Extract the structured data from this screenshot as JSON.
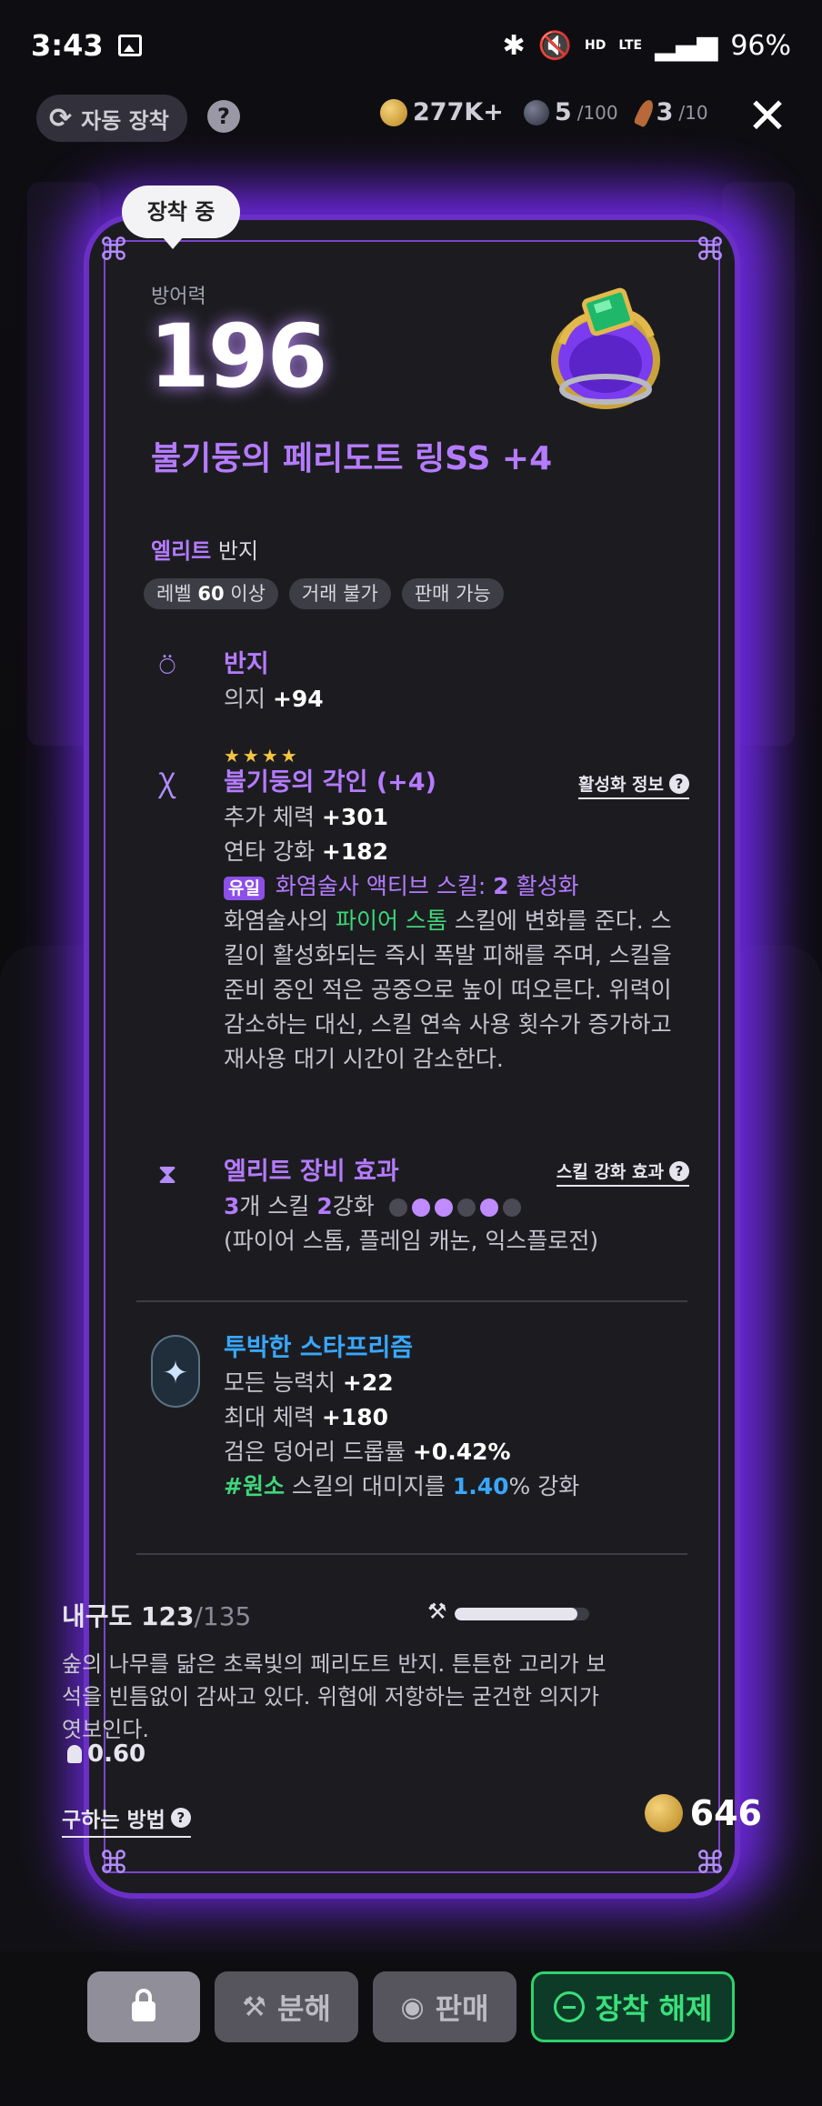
{
  "status_bar": {
    "time": "3:43",
    "battery": "96%",
    "network_hd": "HD",
    "network_lte": "LTE"
  },
  "top_bar": {
    "auto_equip_label": "자동 장착",
    "help": "?",
    "gold": "277K+",
    "orb_value": "5",
    "orb_max": "/100",
    "feather_value": "3",
    "feather_max": "/10",
    "close": "✕"
  },
  "item": {
    "equipped_badge": "장착 중",
    "stat_label": "방어력",
    "stat_value": "196",
    "name": "불기둥의 페리도트 링SS +4",
    "rarity": "엘리트",
    "type": "반지",
    "tags": {
      "level_prefix": "레벨",
      "level_value": "60",
      "level_suffix": "이상",
      "trade": "거래 불가",
      "sell": "판매 가능"
    },
    "base": {
      "title": "반지",
      "stat_name": "의지",
      "stat_value": "+94"
    },
    "engraving": {
      "stars": "★★★★",
      "title": "불기둥의 각인 (+4)",
      "info_link": "활성화 정보",
      "stat1_name": "추가 체력",
      "stat1_value": "+301",
      "stat2_name": "연타 강화",
      "stat2_value": "+182",
      "unique_badge": "유일",
      "active_skill_text": "화염술사 액티브 스킬:",
      "active_skill_value": "2",
      "active_skill_suffix": "활성화",
      "desc_prefix": "화염술사의",
      "desc_skill": "파이어 스톰",
      "desc_suffix": "스킬에 변화를 준다.",
      "desc_rest": "스킬이 활성화되는 즉시 폭발 피해를 주며, 스킬을 준비 중인 적은 공중으로 높이 떠오른다. 위력이 감소하는 대신, 스킬 연속 사용 횟수가 증가하고 재사용 대기 시간이 감소한다."
    },
    "elite_effect": {
      "title": "엘리트 장비 효과",
      "info_link": "스킬 강화 효과",
      "count": "3",
      "count_suffix": "개 스킬",
      "level": "2",
      "level_suffix": "강화",
      "dots_on": [
        false,
        true,
        true,
        false,
        true,
        false
      ],
      "skills": "(파이어 스톰, 플레임 캐논, 익스플로전)"
    },
    "prism": {
      "title": "투박한 스타프리즘",
      "s1_name": "모든 능력치",
      "s1_value": "+22",
      "s2_name": "최대 체력",
      "s2_value": "+180",
      "s3_name": "검은 덩어리 드롭률",
      "s3_value": "+0.42%",
      "s4_tag": "#원소",
      "s4_mid": "스킬의 대미지를",
      "s4_value": "1.40",
      "s4_suffix": "% 강화"
    },
    "durability": {
      "label": "내구도",
      "value": "123",
      "max": "/135",
      "fraction": 0.911
    },
    "description": "숲의 나무를 닮은 초록빛의 페리도트 반지. 튼튼한 고리가 보석을 빈틈없이 감싸고 있다. 위협에 저항하는 굳건한 의지가 엿보인다.",
    "weight": "0.60",
    "how_to_obtain": "구하는 방법",
    "price": "646"
  },
  "actions": {
    "lock": "",
    "disassemble": "분해",
    "sell": "판매",
    "unequip": "장착 해제"
  }
}
